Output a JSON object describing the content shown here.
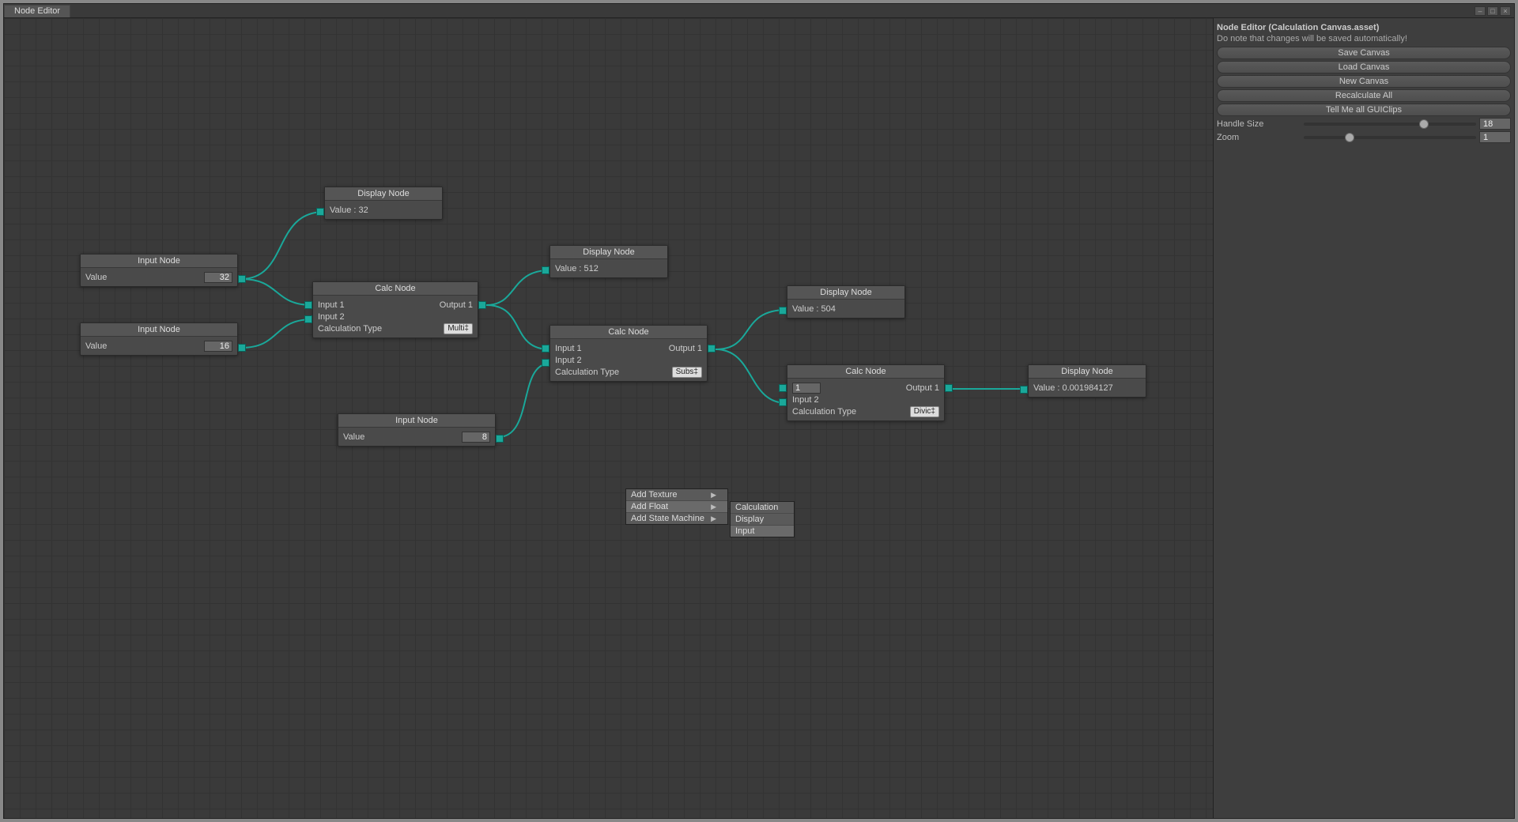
{
  "tab_title": "Node Editor",
  "sidebar": {
    "title": "Node Editor (Calculation Canvas.asset)",
    "note": "Do note that changes will be saved automatically!",
    "buttons": [
      "Save Canvas",
      "Load Canvas",
      "New Canvas",
      "Recalculate All",
      "Tell Me all GUIClips"
    ],
    "handle_size_label": "Handle Size",
    "handle_size_value": "18",
    "zoom_label": "Zoom",
    "zoom_value": "1"
  },
  "nodes": {
    "input1": {
      "title": "Input Node",
      "value_label": "Value",
      "value": "32"
    },
    "input2": {
      "title": "Input Node",
      "value_label": "Value",
      "value": "16"
    },
    "input3": {
      "title": "Input Node",
      "value_label": "Value",
      "value": "8"
    },
    "calc1": {
      "title": "Calc Node",
      "in1": "Input 1",
      "in2": "Input 2",
      "out": "Output 1",
      "ctype_label": "Calculation Type",
      "ctype": "Multi‡"
    },
    "calc2": {
      "title": "Calc Node",
      "in1": "Input 1",
      "in2": "Input 2",
      "out": "Output 1",
      "ctype_label": "Calculation Type",
      "ctype": "Subs‡"
    },
    "calc3": {
      "title": "Calc Node",
      "in1_value": "1",
      "in2": "Input 2",
      "out": "Output 1",
      "ctype_label": "Calculation Type",
      "ctype": "Divic‡"
    },
    "disp1": {
      "title": "Display Node",
      "value": "Value : 32"
    },
    "disp2": {
      "title": "Display Node",
      "value": "Value : 512"
    },
    "disp3": {
      "title": "Display Node",
      "value": "Value : 504"
    },
    "disp4": {
      "title": "Display Node",
      "value": "Value : 0.001984127"
    }
  },
  "context_menu": {
    "items": [
      "Add Texture",
      "Add Float",
      "Add State Machine"
    ],
    "submenu": [
      "Calculation",
      "Display",
      "Input"
    ]
  }
}
